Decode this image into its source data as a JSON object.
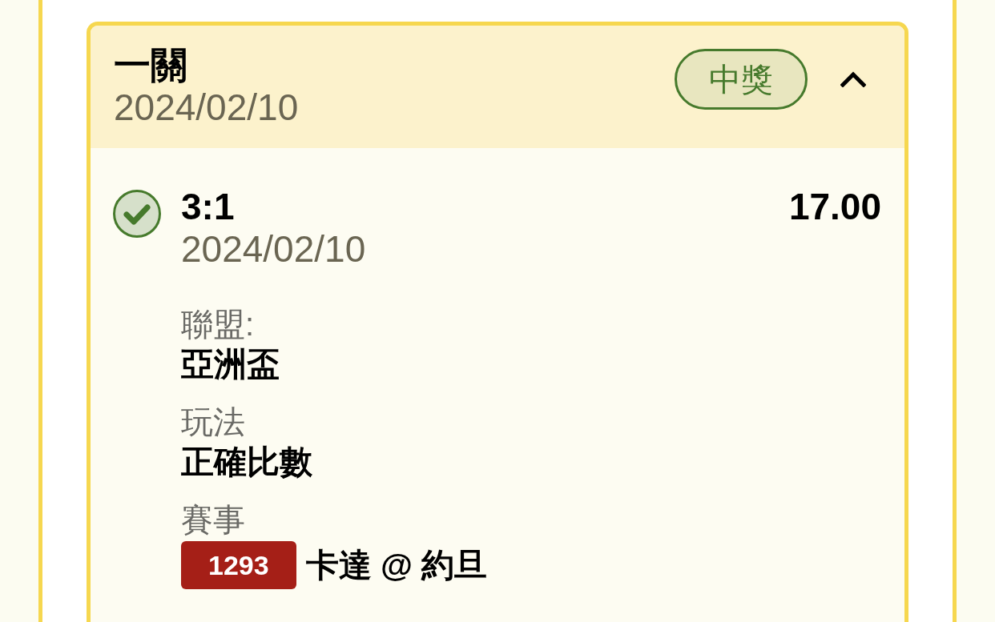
{
  "bet": {
    "title": "一關",
    "date": "2024/02/10",
    "status": {
      "label": "中獎",
      "kind": "won"
    },
    "expanded": true,
    "selections": [
      {
        "won": true,
        "pick": "3:1",
        "odds": "17.00",
        "date": "2024/02/10",
        "details": [
          {
            "kind": "text",
            "label": "聯盟:",
            "value": "亞洲盃"
          },
          {
            "kind": "text",
            "label": "玩法",
            "value": "正確比數"
          },
          {
            "kind": "event",
            "label": "賽事",
            "code": "1293",
            "value": "卡達 @ 約旦"
          }
        ]
      }
    ]
  }
}
